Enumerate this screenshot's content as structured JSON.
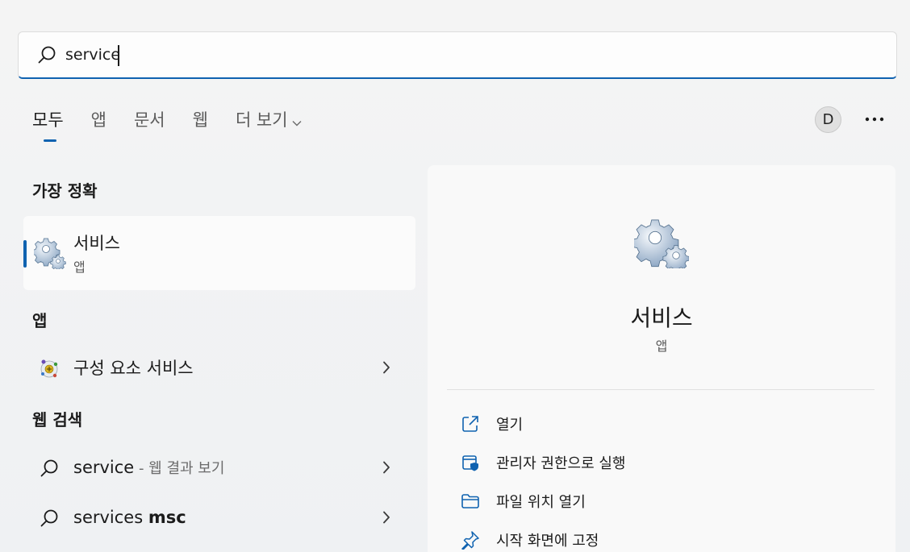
{
  "search": {
    "value": "service",
    "placeholder": ""
  },
  "tabs": [
    {
      "label": "모두"
    },
    {
      "label": "앱"
    },
    {
      "label": "문서"
    },
    {
      "label": "웹"
    },
    {
      "label": "더 보기"
    }
  ],
  "user": {
    "initial": "D"
  },
  "sections": {
    "best_match": "가장 정확",
    "apps": "앱",
    "web": "웹 검색"
  },
  "best_match": {
    "name": "서비스",
    "type": "앱"
  },
  "apps": [
    {
      "name": "구성 요소 서비스"
    }
  ],
  "web_results": [
    {
      "query": "service",
      "hint": " - 웹 결과 보기"
    },
    {
      "query_normal": "services ",
      "query_bold": "msc"
    }
  ],
  "preview": {
    "name": "서비스",
    "type": "앱",
    "actions": [
      {
        "label": "열기",
        "icon": "open-external-icon"
      },
      {
        "label": "관리자 권한으로 실행",
        "icon": "admin-shield-icon"
      },
      {
        "label": "파일 위치 열기",
        "icon": "folder-icon"
      },
      {
        "label": "시작 화면에 고정",
        "icon": "pin-icon"
      }
    ]
  },
  "colors": {
    "accent": "#0f62b0",
    "background": "#f3f3f3"
  }
}
